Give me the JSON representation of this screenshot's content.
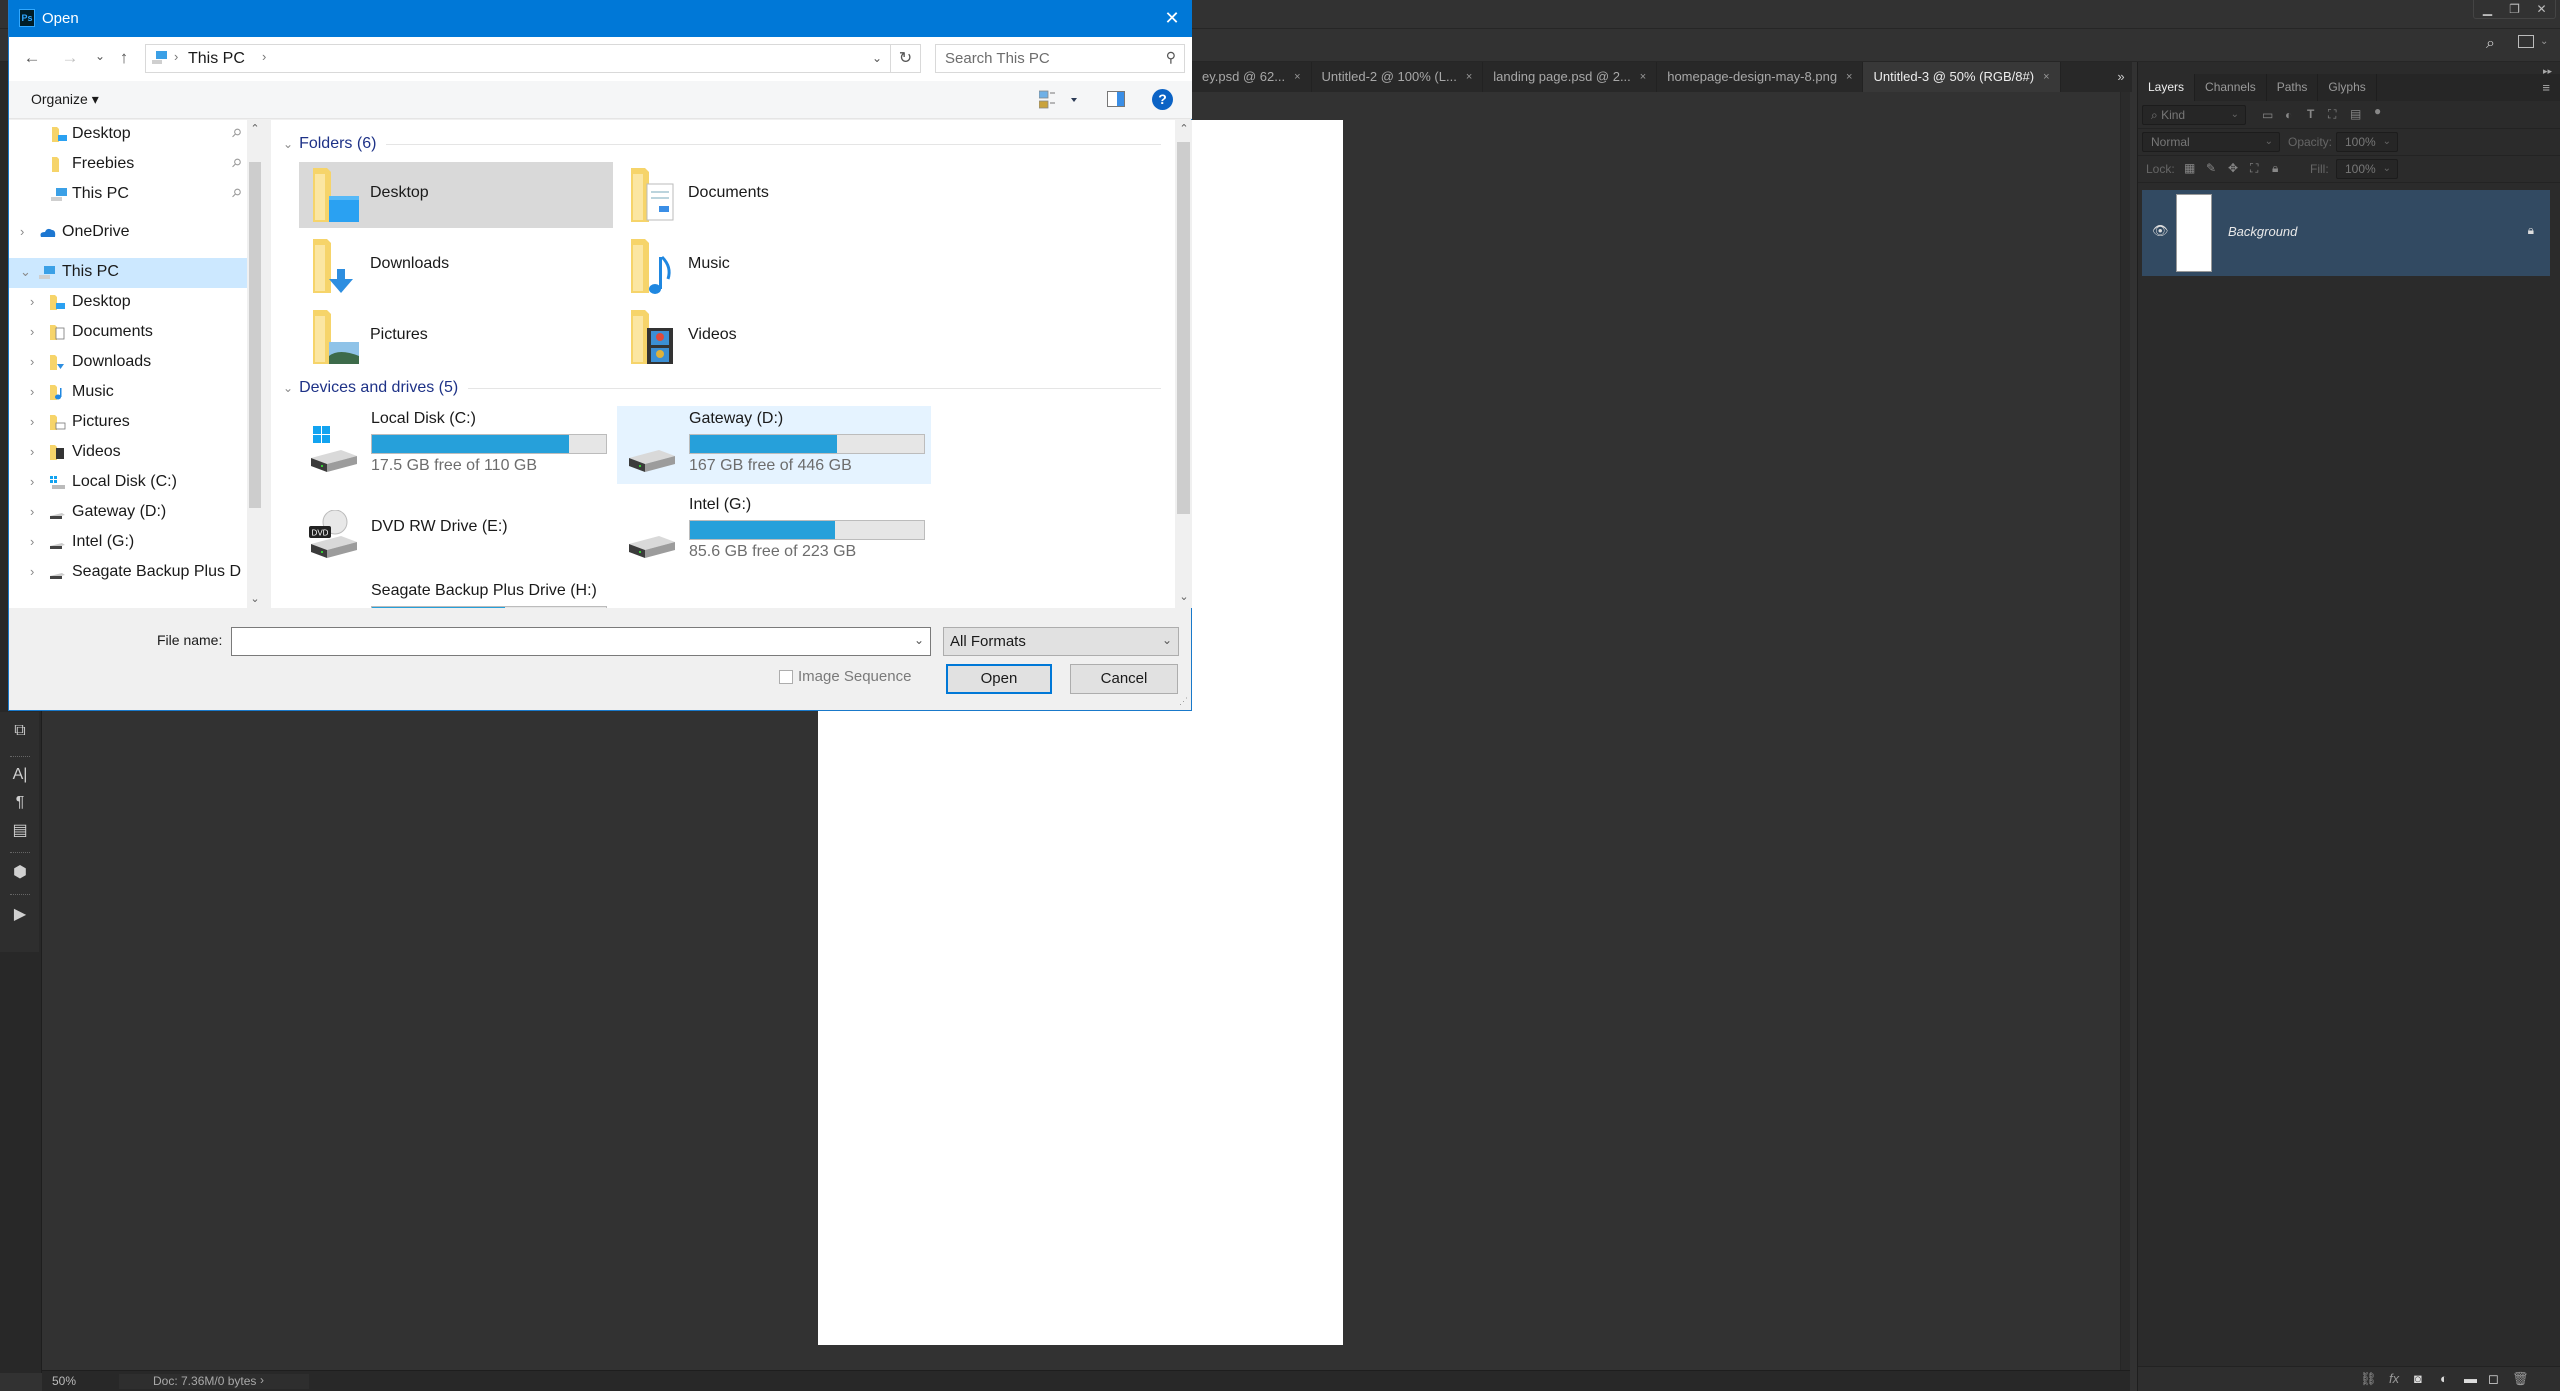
{
  "photoshop": {
    "window_controls": {
      "minimize": "▁",
      "restore": "❐",
      "close": "✕"
    },
    "options_bar": {
      "search_icon": "search-icon",
      "workspace_icon": "workspace-icon"
    },
    "document_tabs": [
      {
        "label": "ey.psd @ 62...",
        "active": false
      },
      {
        "label": "Untitled-2 @ 100% (L...",
        "active": false
      },
      {
        "label": "landing page.psd @ 2...",
        "active": false
      },
      {
        "label": "homepage-design-may-8.png",
        "active": false
      },
      {
        "label": "Untitled-3 @ 50% (RGB/8#)",
        "active": true
      }
    ],
    "tab_close_glyph": "×",
    "tab_overflow": "»",
    "status_bar": {
      "zoom": "50%",
      "doc_info": "Doc: 7.36M/0 bytes",
      "arrow": "›"
    },
    "left_panel_icons": [
      "arrange-icon",
      "character-icon",
      "paragraph-icon",
      "paragraph-styles-icon",
      "3d-icon",
      "actions-play-icon"
    ],
    "right_panel": {
      "tabs": [
        {
          "label": "Layers",
          "active": true
        },
        {
          "label": "Channels",
          "active": false
        },
        {
          "label": "Paths",
          "active": false
        },
        {
          "label": "Glyphs",
          "active": false
        }
      ],
      "filter_kind": "Kind",
      "blend_mode": "Normal",
      "opacity_label": "Opacity:",
      "opacity_value": "100%",
      "lock_label": "Lock:",
      "fill_label": "Fill:",
      "fill_value": "100%",
      "layers": [
        {
          "name": "Background",
          "visible": true,
          "locked": true,
          "selected": true
        }
      ],
      "footer_icons": [
        "link-layers-icon",
        "fx-icon",
        "layer-mask-icon",
        "adjustment-icon",
        "group-icon",
        "new-layer-icon",
        "trash-icon"
      ]
    }
  },
  "dialog": {
    "title": "Open",
    "app_icon_text": "Ps",
    "close_glyph": "✕",
    "nav": {
      "back": "←",
      "forward": "→",
      "recent": "⌄",
      "up": "↑"
    },
    "address": {
      "crumbs": [
        "This PC"
      ],
      "separator": "›"
    },
    "refresh_glyph": "↻",
    "search": {
      "placeholder": "Search This PC",
      "value": ""
    },
    "toolbar": {
      "organize": "Organize ▾",
      "help": "?"
    },
    "nav_pane": {
      "items": [
        {
          "label": "Desktop",
          "icon": "desktop-folder-icon",
          "pinned": true,
          "indent": 1,
          "chevron": false
        },
        {
          "label": "Freebies",
          "icon": "folder-icon",
          "pinned": true,
          "indent": 1,
          "chevron": false
        },
        {
          "label": "This PC",
          "icon": "pc-icon",
          "pinned": true,
          "indent": 1,
          "chevron": false
        },
        {
          "label": "OneDrive",
          "icon": "onedrive-icon",
          "pinned": false,
          "indent": 0,
          "chevron": "›"
        },
        {
          "label": "This PC",
          "icon": "pc-icon",
          "pinned": false,
          "indent": 0,
          "chevron": "⌄",
          "selected": true
        },
        {
          "label": "Desktop",
          "icon": "desktop-folder-icon",
          "indent": 1,
          "chevron": "›"
        },
        {
          "label": "Documents",
          "icon": "documents-folder-icon",
          "indent": 1,
          "chevron": "›"
        },
        {
          "label": "Downloads",
          "icon": "downloads-folder-icon",
          "indent": 1,
          "chevron": "›"
        },
        {
          "label": "Music",
          "icon": "music-folder-icon",
          "indent": 1,
          "chevron": "›"
        },
        {
          "label": "Pictures",
          "icon": "pictures-folder-icon",
          "indent": 1,
          "chevron": "›"
        },
        {
          "label": "Videos",
          "icon": "videos-folder-icon",
          "indent": 1,
          "chevron": "›"
        },
        {
          "label": "Local Disk (C:)",
          "icon": "windows-drive-icon",
          "indent": 1,
          "chevron": "›"
        },
        {
          "label": "Gateway (D:)",
          "icon": "drive-icon",
          "indent": 1,
          "chevron": "›"
        },
        {
          "label": "Intel (G:)",
          "icon": "drive-icon",
          "indent": 1,
          "chevron": "›"
        },
        {
          "label": "Seagate Backup Plus D",
          "icon": "drive-icon",
          "indent": 1,
          "chevron": "›"
        }
      ],
      "pin_glyph": "📌"
    },
    "folders_group": {
      "label": "Folders (6)",
      "items": [
        {
          "label": "Desktop",
          "icon": "desktop-folder-icon",
          "selected": true
        },
        {
          "label": "Documents",
          "icon": "documents-folder-icon"
        },
        {
          "label": "Downloads",
          "icon": "downloads-folder-icon"
        },
        {
          "label": "Music",
          "icon": "music-folder-icon"
        },
        {
          "label": "Pictures",
          "icon": "pictures-folder-icon"
        },
        {
          "label": "Videos",
          "icon": "videos-folder-icon"
        }
      ]
    },
    "drives_group": {
      "label": "Devices and drives (5)",
      "items": [
        {
          "name": "Local Disk (C:)",
          "free": "17.5 GB free of 110 GB",
          "used_fraction": 0.84,
          "icon": "windows-drive-icon"
        },
        {
          "name": "Gateway (D:)",
          "free": "167 GB free of 446 GB",
          "used_fraction": 0.63,
          "icon": "drive-icon",
          "hover": true
        },
        {
          "name": "DVD RW Drive (E:)",
          "free": null,
          "used_fraction": null,
          "icon": "dvd-drive-icon"
        },
        {
          "name": "Intel (G:)",
          "free": "85.6 GB free of 223 GB",
          "used_fraction": 0.62,
          "icon": "drive-icon"
        },
        {
          "name": "Seagate Backup Plus Drive (H:)",
          "free": null,
          "used_fraction": 0.57,
          "icon": "drive-icon"
        }
      ]
    },
    "file_name": {
      "label": "File name:",
      "value": ""
    },
    "filter": {
      "selected": "All Formats"
    },
    "image_sequence": {
      "label": "Image Sequence",
      "checked": false
    },
    "buttons": {
      "open": "Open",
      "cancel": "Cancel"
    },
    "colors": {
      "title_bar": "#0078d7",
      "bar_fill": "#26a0da",
      "selection": "#cce8ff",
      "group_header": "#1e3287"
    }
  }
}
